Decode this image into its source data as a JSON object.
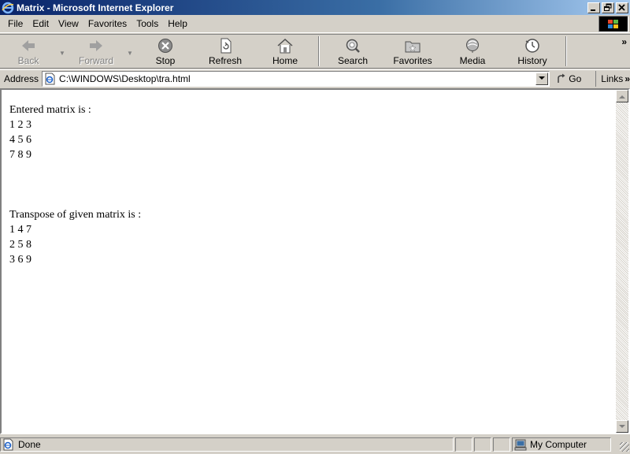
{
  "window": {
    "title": "Matrix - Microsoft Internet Explorer",
    "app_icon": "ie-icon",
    "buttons": [
      "minimize",
      "maximize",
      "close"
    ]
  },
  "menu": {
    "items": [
      {
        "label": "File"
      },
      {
        "label": "Edit"
      },
      {
        "label": "View"
      },
      {
        "label": "Favorites"
      },
      {
        "label": "Tools"
      },
      {
        "label": "Help"
      }
    ]
  },
  "toolbar": {
    "buttons": [
      {
        "label": "Back",
        "icon": "back-arrow-icon",
        "enabled": false
      },
      {
        "label": "Forward",
        "icon": "forward-arrow-icon",
        "enabled": false
      },
      {
        "label": "Stop",
        "icon": "stop-icon",
        "enabled": true
      },
      {
        "label": "Refresh",
        "icon": "refresh-icon",
        "enabled": true
      },
      {
        "label": "Home",
        "icon": "home-icon",
        "enabled": true
      },
      {
        "label": "Search",
        "icon": "search-icon",
        "enabled": true
      },
      {
        "label": "Favorites",
        "icon": "favorites-icon",
        "enabled": true
      },
      {
        "label": "Media",
        "icon": "media-icon",
        "enabled": true
      },
      {
        "label": "History",
        "icon": "history-icon",
        "enabled": true
      }
    ],
    "more": "»"
  },
  "address": {
    "label": "Address",
    "url": "C:\\WINDOWS\\Desktop\\tra.html",
    "go_label": "Go",
    "links_label": "Links",
    "links_more": "»"
  },
  "page": {
    "entered_heading": "Entered matrix is :",
    "entered_rows": [
      "1 2 3",
      "4 5 6",
      "7 8 9"
    ],
    "transpose_heading": "Transpose of given matrix is :",
    "transpose_rows": [
      "1 4 7",
      "2 5 8",
      "3 6 9"
    ]
  },
  "status": {
    "text": "Done",
    "zone": "My Computer"
  },
  "colors": {
    "titlebar_start": "#0a246a",
    "titlebar_end": "#a6caf0",
    "chrome": "#d4d0c8"
  }
}
